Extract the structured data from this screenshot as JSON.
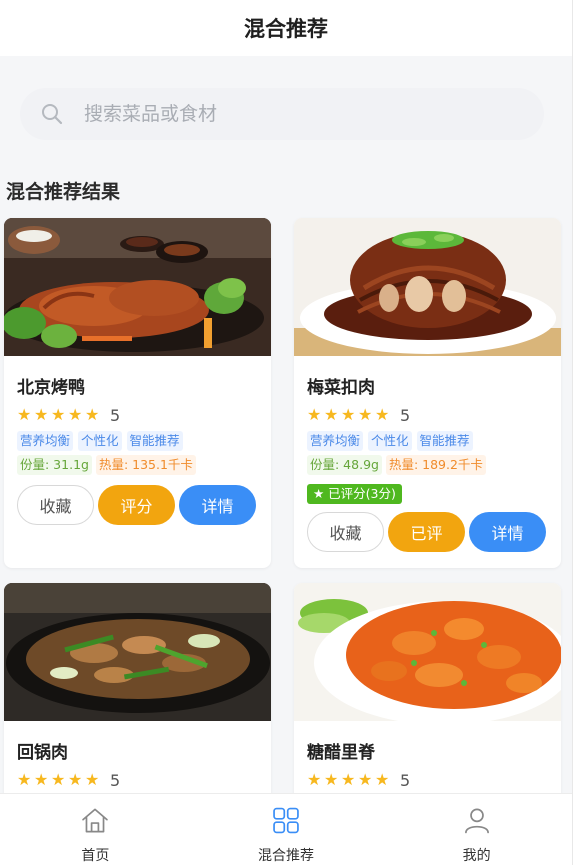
{
  "header": {
    "title": "混合推荐"
  },
  "search": {
    "placeholder": "搜索菜品或食材"
  },
  "section": {
    "title": "混合推荐结果"
  },
  "colors": {
    "accent": "#3a8ef6",
    "star": "#f7b81f",
    "rate_button": "#f2a50f",
    "rated_badge": "#4fb81f"
  },
  "cards": [
    {
      "name": "北京烤鸭",
      "rating": "5",
      "tags": [
        "营养均衡",
        "个性化",
        "智能推荐"
      ],
      "portion": "份量: 31.1g",
      "calorie": "热量: 135.1千卡",
      "fav_label": "收藏",
      "rate_label": "评分",
      "detail_label": "详情"
    },
    {
      "name": "梅菜扣肉",
      "rating": "5",
      "tags": [
        "营养均衡",
        "个性化",
        "智能推荐"
      ],
      "portion": "份量: 48.9g",
      "calorie": "热量: 189.2千卡",
      "rated_badge": "★ 已评分(3分)",
      "fav_label": "收藏",
      "rate_label": "已评",
      "detail_label": "详情"
    },
    {
      "name": "回锅肉",
      "rating": "5"
    },
    {
      "name": "糖醋里脊",
      "rating": "5"
    }
  ],
  "tabbar": [
    {
      "label": "首页",
      "icon": "home-icon",
      "active": false
    },
    {
      "label": "混合推荐",
      "icon": "grid-icon",
      "active": true
    },
    {
      "label": "我的",
      "icon": "user-icon",
      "active": false
    }
  ]
}
